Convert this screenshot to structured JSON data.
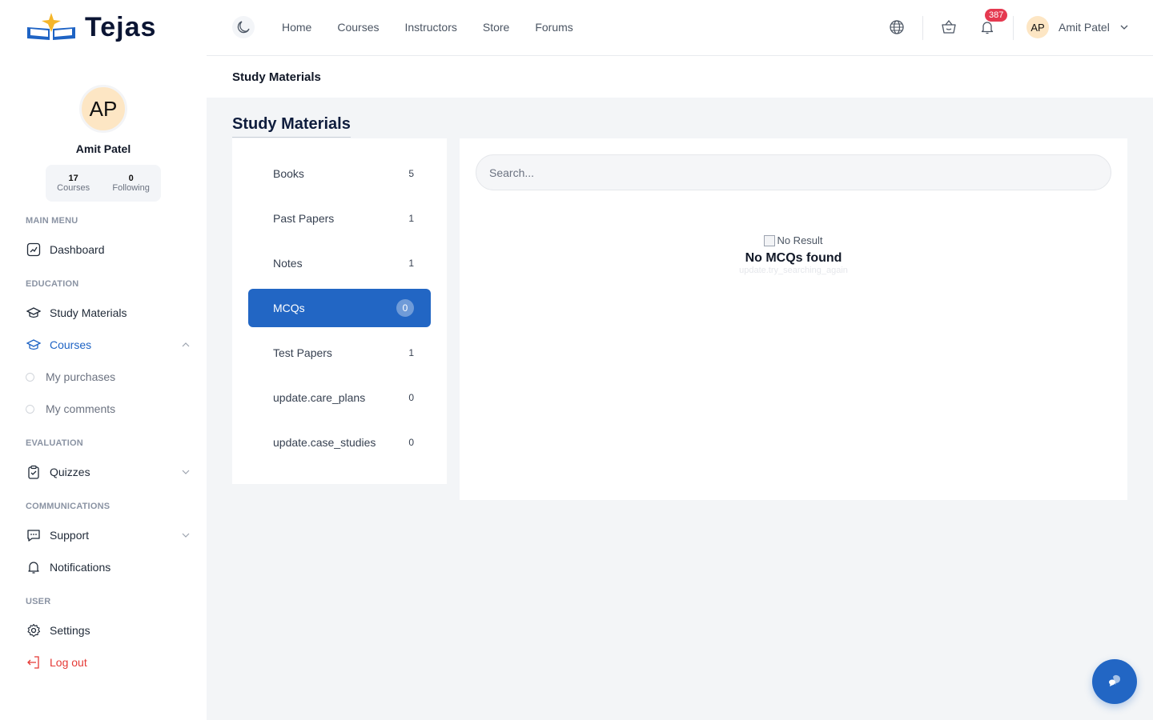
{
  "brand": {
    "name": "Tejas"
  },
  "profile": {
    "initials": "AP",
    "name": "Amit Patel",
    "stats": [
      {
        "value": "17",
        "label": "Courses"
      },
      {
        "value": "0",
        "label": "Following"
      }
    ]
  },
  "sidebar": {
    "main_menu_title": "MAIN MENU",
    "dashboard": "Dashboard",
    "education_title": "EDUCATION",
    "study_materials": "Study Materials",
    "courses": "Courses",
    "my_purchases": "My purchases",
    "my_comments": "My comments",
    "evaluation_title": "EVALUATION",
    "quizzes": "Quizzes",
    "communications_title": "COMMUNICATIONS",
    "support": "Support",
    "notifications": "Notifications",
    "user_title": "USER",
    "settings": "Settings",
    "logout": "Log out"
  },
  "topnav": {
    "links": [
      "Home",
      "Courses",
      "Instructors",
      "Store",
      "Forums"
    ],
    "notification_count": "387",
    "user_initials": "AP",
    "user_name": "Amit Patel"
  },
  "breadcrumb": "Study Materials",
  "page_title": "Study Materials",
  "categories": [
    {
      "label": "Books",
      "count": "5"
    },
    {
      "label": "Past Papers",
      "count": "1"
    },
    {
      "label": "Notes",
      "count": "1"
    },
    {
      "label": "MCQs",
      "count": "0",
      "active": true
    },
    {
      "label": "Test Papers",
      "count": "1"
    },
    {
      "label": "update.care_plans",
      "count": "0"
    },
    {
      "label": "update.case_studies",
      "count": "0"
    }
  ],
  "search": {
    "placeholder": "Search..."
  },
  "empty_state": {
    "image_alt": "No Result",
    "title": "No MCQs found",
    "subtitle": "update.try_searching_again"
  },
  "colors": {
    "primary": "#2266c4",
    "danger": "#e53935",
    "badge": "#e53950"
  }
}
